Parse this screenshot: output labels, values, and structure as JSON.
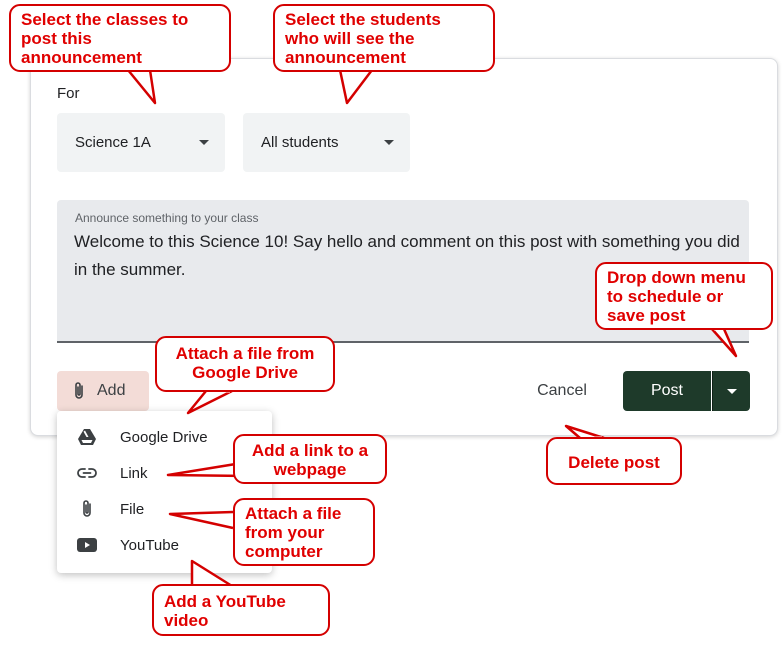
{
  "form": {
    "for_label": "For",
    "class_select": "Science 1A",
    "students_select": "All students",
    "announce_label": "Announce something to your class",
    "announce_text": "Welcome to this Science 10! Say hello and comment on this post with something you did in the summer.",
    "add_label": "Add",
    "cancel_label": "Cancel",
    "post_label": "Post"
  },
  "menu": {
    "items": [
      {
        "label": "Google Drive",
        "icon": "google-drive-icon"
      },
      {
        "label": "Link",
        "icon": "link-icon"
      },
      {
        "label": "File",
        "icon": "paperclip-icon"
      },
      {
        "label": "YouTube",
        "icon": "youtube-icon"
      }
    ]
  },
  "callouts": {
    "select_classes": "Select the classes to\npost this\nannouncement",
    "select_students": "Select the students\nwho will see the\nannouncement",
    "drop_down": "Drop down menu\nto schedule or\nsave post",
    "google_drive": "Attach a file from\nGoogle Drive",
    "link": "Add a link to a\nwebpage",
    "file": "Attach a file\nfrom your\ncomputer",
    "delete": "Delete post",
    "youtube": "Add a YouTube\nvideo"
  },
  "colors": {
    "callout_red": "#e00000",
    "post_button": "#1e3a2a",
    "add_button": "#f3dcd7"
  }
}
